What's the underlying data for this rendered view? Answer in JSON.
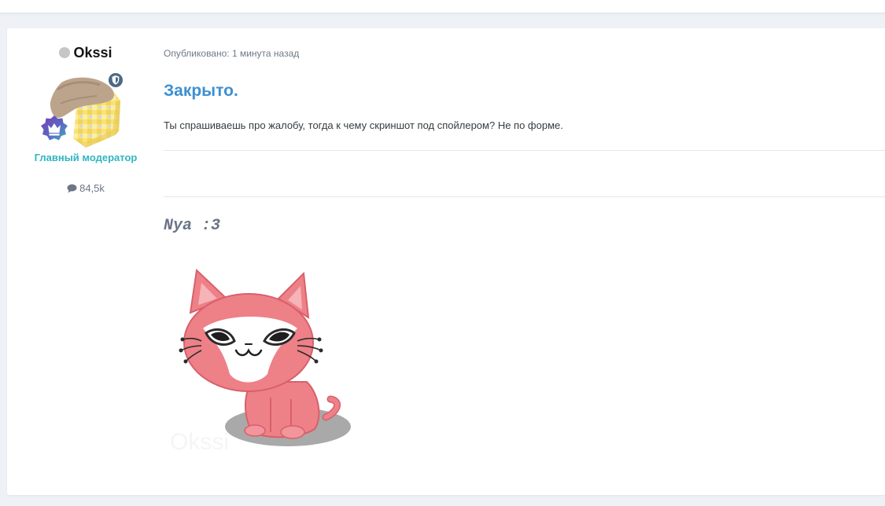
{
  "author": {
    "name": "Okssi",
    "role": "Главный модератор",
    "post_count": "84,5k",
    "status": "offline",
    "icons": [
      "status-dot-icon",
      "moderator-shield-icon",
      "crown-rank-icon",
      "speech-bubble-icon"
    ]
  },
  "post": {
    "meta": "Опубликовано: 1 минута назад",
    "title": "Закрыто.",
    "body": "Ты спрашиваешь про жалобу, тогда к чему скриншот под спойлером? Не по форме."
  },
  "signature": {
    "text": "Nya :3",
    "image_watermark": "Okssi"
  },
  "colors": {
    "accent_title": "#3d8fd1",
    "role_color": "#30b5c2",
    "page_bg": "#eef1f6"
  }
}
